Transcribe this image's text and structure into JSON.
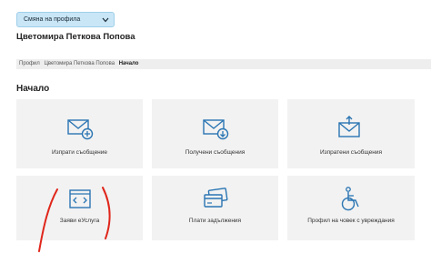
{
  "profile_switch": {
    "label": "Смяна на профила",
    "icon": "chevron-down-icon"
  },
  "user": {
    "name": "Цветомира Петкова Попова"
  },
  "breadcrumb": {
    "items": [
      "Профил",
      "Цветомира Петкова Попова",
      "Начало"
    ]
  },
  "section": {
    "title": "Начало"
  },
  "tiles": [
    {
      "label": "Изпрати съобщение",
      "icon": "envelope-plus-icon"
    },
    {
      "label": "Получени съобщения",
      "icon": "envelope-download-icon"
    },
    {
      "label": "Изпратени съобщения",
      "icon": "envelope-upload-icon"
    },
    {
      "label": "Заяви еУслуга",
      "icon": "code-window-icon"
    },
    {
      "label": "Плати задължения",
      "icon": "credit-cards-icon"
    },
    {
      "label": "Профил на човек с увреждания",
      "icon": "wheelchair-icon"
    }
  ],
  "colors": {
    "accent": "#2a75b3",
    "tile_bg": "#f2f2f2",
    "profile_bg": "#c9e6f7",
    "annotation": "#e0261b"
  }
}
